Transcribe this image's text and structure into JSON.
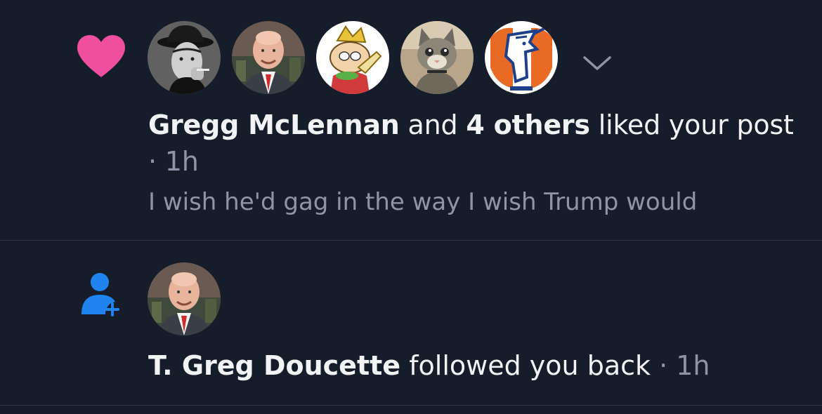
{
  "colors": {
    "background": "#161d2a",
    "divider": "#2c3646",
    "heart": "#ee4f9f",
    "follow_icon": "#1f84f0",
    "secondary_text": "#8b97a8",
    "primary_text": "#f1f3f5"
  },
  "notifications": [
    {
      "type": "like",
      "icon": "heart-icon",
      "avatars": [
        {
          "icon": "avatar-photo-man-in-hat"
        },
        {
          "icon": "avatar-photo-bald-man"
        },
        {
          "icon": "avatar-cartoon-character"
        },
        {
          "icon": "avatar-photo-cat"
        },
        {
          "icon": "avatar-horse-logo"
        }
      ],
      "expand_icon": "chevron-down-icon",
      "actor": "Gregg McLennan",
      "connector": " and ",
      "others": "4 others",
      "action": " liked your post",
      "separator": " · ",
      "time": "1h",
      "preview": "I wish he'd gag in the way I wish Trump would"
    },
    {
      "type": "follow",
      "icon": "user-plus-icon",
      "avatars": [
        {
          "icon": "avatar-photo-bald-man"
        }
      ],
      "actor": "T. Greg Doucette",
      "action": " followed you back",
      "separator": " · ",
      "time": "1h"
    }
  ]
}
